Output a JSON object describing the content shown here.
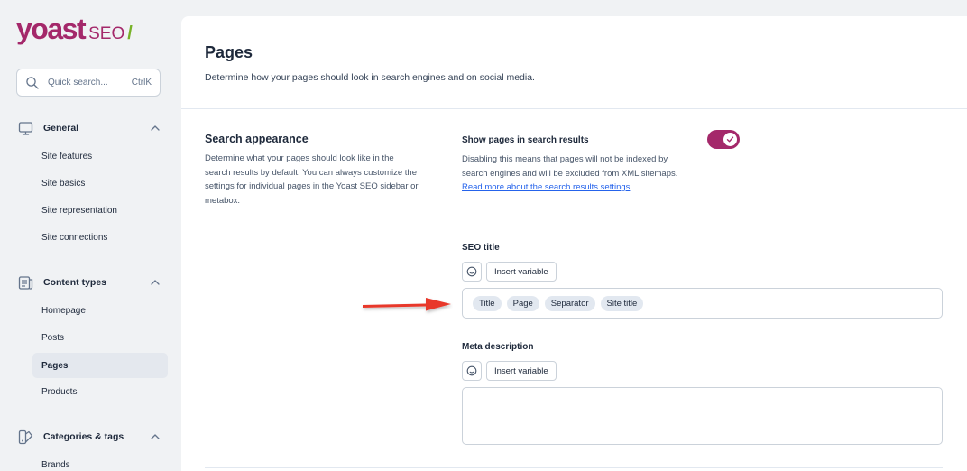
{
  "brand": {
    "word": "yoast",
    "seo": "SEO",
    "slash": "/"
  },
  "search": {
    "placeholder": "Quick search...",
    "shortcut": "CtrlK"
  },
  "sidebar": {
    "groups": [
      {
        "label": "General",
        "items": [
          "Site features",
          "Site basics",
          "Site representation",
          "Site connections"
        ]
      },
      {
        "label": "Content types",
        "items": [
          "Homepage",
          "Posts",
          "Pages",
          "Products"
        ],
        "active": "Pages"
      },
      {
        "label": "Categories & tags",
        "items": [
          "Brands"
        ]
      }
    ]
  },
  "page": {
    "title": "Pages",
    "description": "Determine how your pages should look in search engines and on social media."
  },
  "section": {
    "title": "Search appearance",
    "description": "Determine what your pages should look like in the search results by default. You can always customize the settings for individual pages in the Yoast SEO sidebar or metabox."
  },
  "toggle": {
    "label": "Show pages in search results",
    "description": "Disabling this means that pages will not be indexed by search engines and will be excluded from XML sitemaps.",
    "link": "Read more about the search results settings",
    "enabled": true
  },
  "seo_title": {
    "label": "SEO title",
    "insert_variable": "Insert variable",
    "chips": [
      "Title",
      "Page",
      "Separator",
      "Site title"
    ]
  },
  "meta_description": {
    "label": "Meta description",
    "insert_variable": "Insert variable",
    "value": ""
  },
  "colors": {
    "brand": "#a4286a",
    "accent": "#77b227",
    "arrow": "#e8372c"
  },
  "icons": [
    "search-icon",
    "monitor-icon",
    "content-types-icon",
    "tag-icon",
    "chevron-up-icon",
    "emoji-icon",
    "check-icon",
    "arrow-annotation"
  ]
}
